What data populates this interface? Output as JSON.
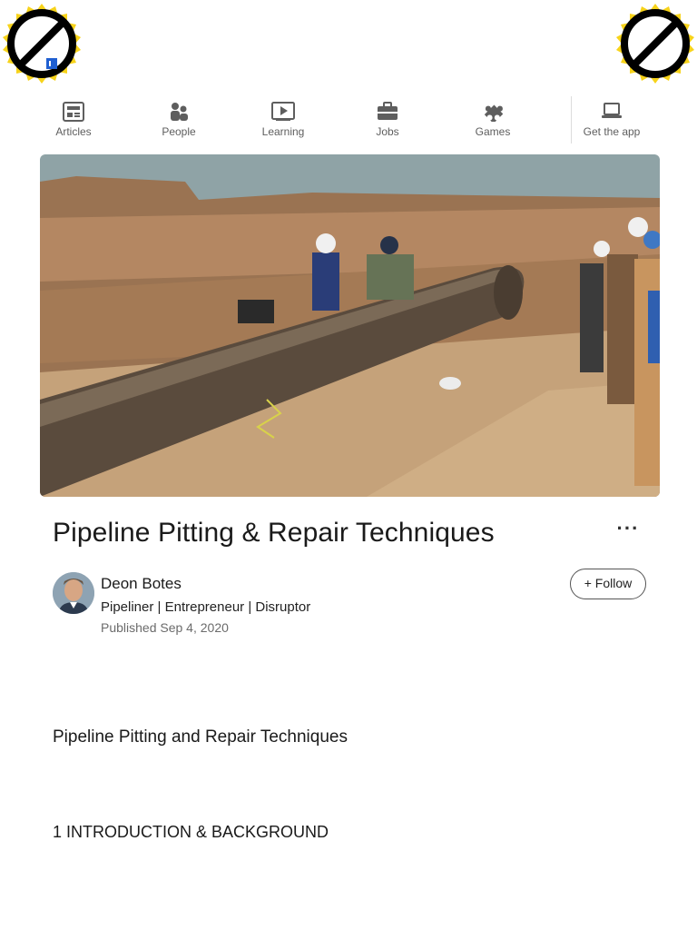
{
  "nav": {
    "items": [
      {
        "label": "Articles",
        "icon": "articles-icon"
      },
      {
        "label": "People",
        "icon": "people-icon"
      },
      {
        "label": "Learning",
        "icon": "learning-icon"
      },
      {
        "label": "Jobs",
        "icon": "jobs-icon"
      },
      {
        "label": "Games",
        "icon": "games-icon"
      },
      {
        "label": "Get the app",
        "icon": "laptop-icon"
      }
    ]
  },
  "article": {
    "title": "Pipeline Pitting & Repair Techniques",
    "more_label": "···",
    "author": {
      "name": "Deon Botes",
      "headline": "Pipeliner | Entrepreneur | Disruptor",
      "published": "Published Sep 4, 2020"
    },
    "follow_label": "+ Follow",
    "subtitle": "Pipeline Pitting and Repair Techniques",
    "section_heading": "1 INTRODUCTION & BACKGROUND"
  },
  "colors": {
    "badge_yellow": "#f7d31a",
    "badge_black": "#000000",
    "nav_text": "#5e5e5e",
    "sky": "#8fa3a6",
    "dirt": "#a87c56",
    "pipe": "#5a4b3d"
  }
}
